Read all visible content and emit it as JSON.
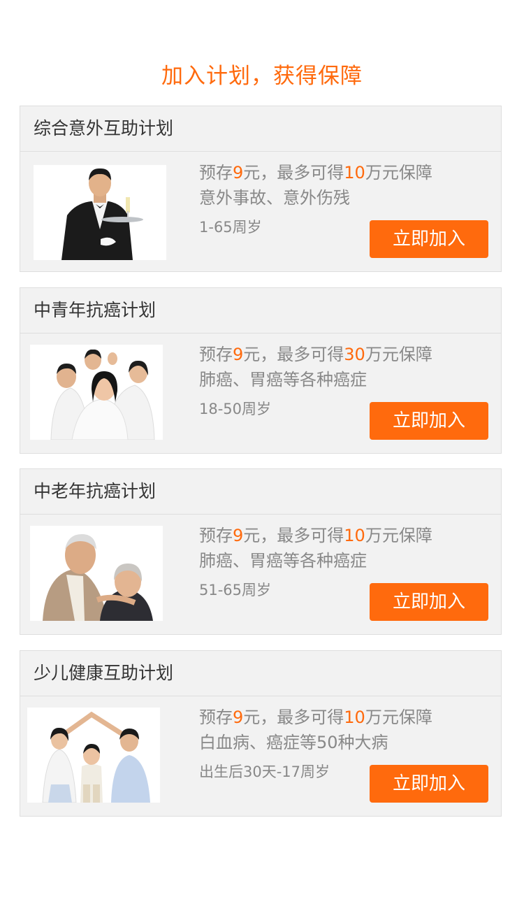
{
  "page_title": "加入计划，获得保障",
  "cards": [
    {
      "title": "综合意外互助计划",
      "deposit_prefix": "预存",
      "deposit_amount": "9",
      "deposit_mid": "元，最多可得",
      "max_amount": "10",
      "deposit_suffix": "万元保障",
      "coverage": "意外事故、意外伤残",
      "age": "1-65周岁",
      "button": "立即加入",
      "photo_icon": "waiter-photo"
    },
    {
      "title": "中青年抗癌计划",
      "deposit_prefix": "预存",
      "deposit_amount": "9",
      "deposit_mid": "元，最多可得",
      "max_amount": "30",
      "deposit_suffix": "万元保障",
      "coverage": "肺癌、胃癌等各种癌症",
      "age": "18-50周岁",
      "button": "立即加入",
      "photo_icon": "young-people-group-photo"
    },
    {
      "title": "中老年抗癌计划",
      "deposit_prefix": "预存",
      "deposit_amount": "9",
      "deposit_mid": "元，最多可得",
      "max_amount": "10",
      "deposit_suffix": "万元保障",
      "coverage": "肺癌、胃癌等各种癌症",
      "age": "51-65周岁",
      "button": "立即加入",
      "photo_icon": "elderly-couple-photo"
    },
    {
      "title": "少儿健康互助计划",
      "deposit_prefix": "预存",
      "deposit_amount": "9",
      "deposit_mid": "元，最多可得",
      "max_amount": "10",
      "deposit_suffix": "万元保障",
      "coverage": "白血病、癌症等50种大病",
      "age": "出生后30天-17周岁",
      "button": "立即加入",
      "photo_icon": "family-photo"
    }
  ],
  "colors": {
    "accent": "#ff6a0d",
    "card_background": "#f2f2f2",
    "secondary_text": "#888888",
    "primary_text": "#333333"
  }
}
